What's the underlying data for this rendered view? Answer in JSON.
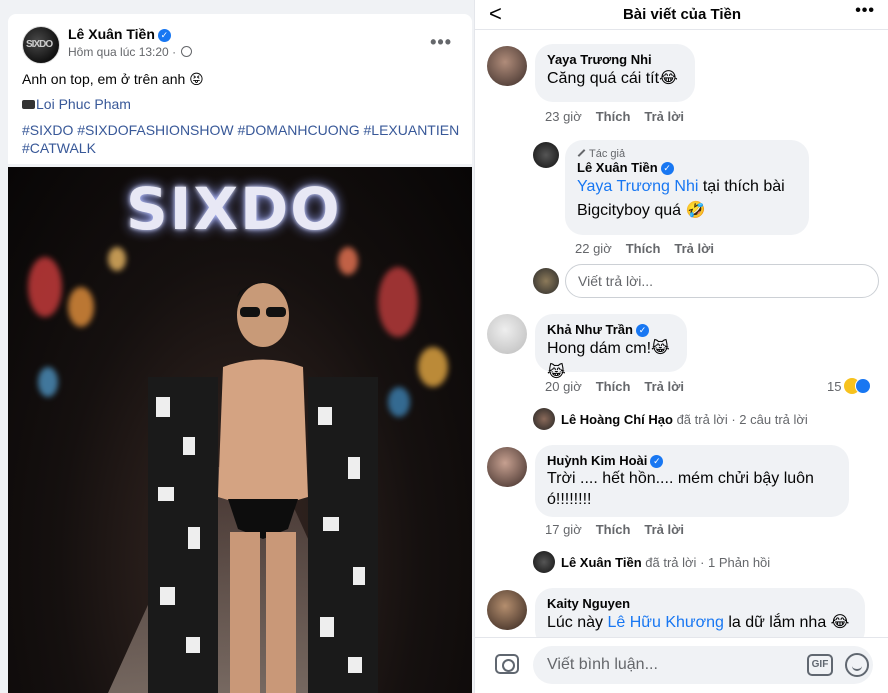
{
  "post": {
    "author": "Lê Xuân Tiền",
    "timestamp": "Hôm qua lúc 13:20 ·",
    "text": "Anh on top, em ở trên anh 😝",
    "photo_credit": "Loi Phuc Pham",
    "hashtags": "#SIXDO #SIXDOFASHIONSHOW #DOMANHCUONG #LEXUANTIEN #CATWALK",
    "more_label": "•••",
    "photo_sign": "SIXDO",
    "avatar_monogram": "SIXDO"
  },
  "mobile": {
    "back_label": "<",
    "title": "Bài viết của Tiền",
    "more_label": "•••",
    "comments": [
      {
        "name": "Yaya Trương Nhi",
        "text": "Căng quá cái tít😂",
        "time": "23 giờ",
        "like": "Thích",
        "reply": "Trả lời"
      },
      {
        "badge": "Tác giả",
        "name": "Lê Xuân Tiền",
        "mention": "Yaya Trương Nhi",
        "text": " tại thích bài Bigcityboy quá 🤣",
        "time": "22 giờ",
        "like": "Thích",
        "reply": "Trả lời"
      },
      {
        "name": "Khả Như Trần",
        "text": "Hong dám cm!😹😹",
        "time": "20 giờ",
        "like": "Thích",
        "reply": "Trả lời",
        "reactions": "15"
      },
      {
        "name": "Huỳnh Kim Hoài",
        "text": "Trời .... hết hồn.... mém chửi bậy luôn ó!!!!!!!!",
        "time": "17 giờ",
        "like": "Thích",
        "reply": "Trả lời"
      },
      {
        "name": "Kaity Nguyen",
        "text_pre": "Lúc này ",
        "mention": "Lê Hữu Khương",
        "text_post": " la dữ lắm nha 😂"
      }
    ],
    "reply_placeholder": "Viết trả lời...",
    "reply_threads": [
      {
        "name": "Lê Hoàng Chí Hạo",
        "action": " đã trả lời",
        "count": " · 2 câu trả lời"
      },
      {
        "name": "Lê Xuân Tiền",
        "action": " đã trả lời",
        "count": " · 1 Phản hồi"
      }
    ],
    "comment_placeholder": "Viết bình luận...",
    "gif_label": "GIF"
  }
}
